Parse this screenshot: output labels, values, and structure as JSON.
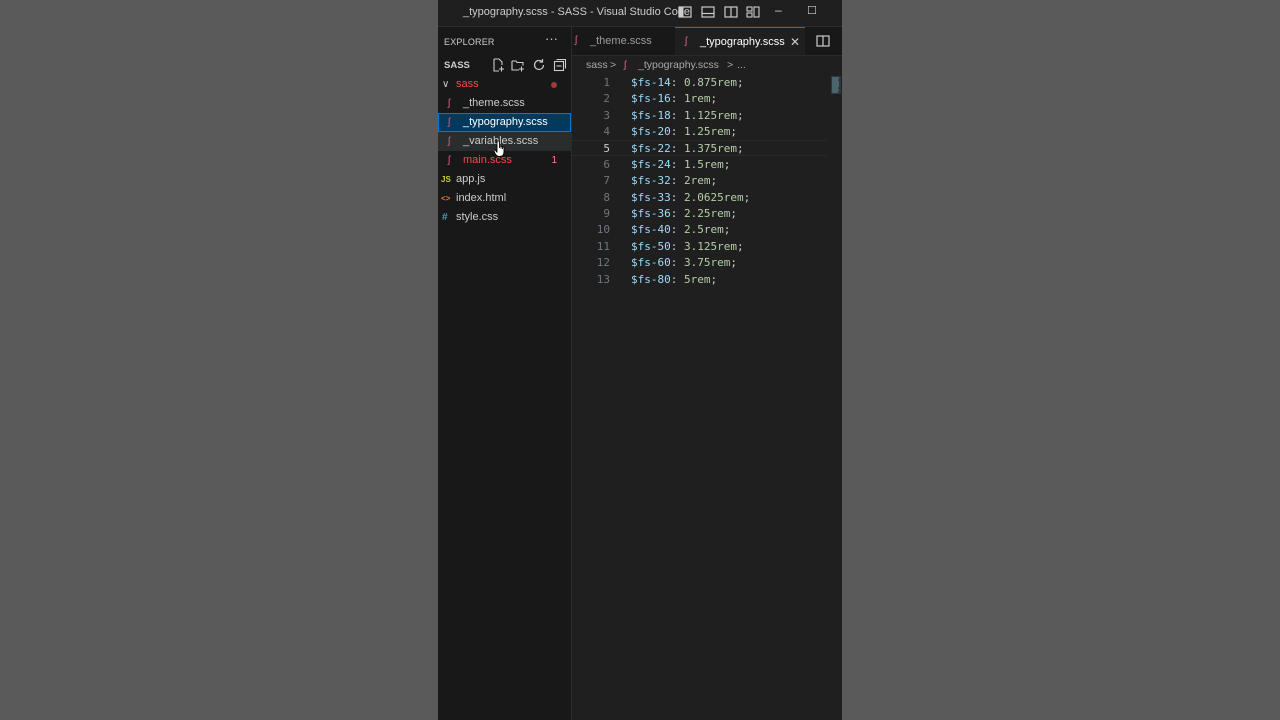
{
  "window": {
    "title": "_typography.scss - SASS - Visual Studio Code",
    "minimize_glyph": "–",
    "maximize_glyph": "☐"
  },
  "sidebar": {
    "title": "EXPLORER",
    "more_glyph": "···",
    "root": "SASS",
    "items": [
      {
        "label": "sass",
        "icon": "chevron-down-icon",
        "icon_glyph": "∨",
        "color": "#f14c4c"
      },
      {
        "label": "_theme.scss",
        "icon": "sass-file-icon",
        "icon_glyph": "ʃ",
        "color": "#cccccc"
      },
      {
        "label": "_typography.scss",
        "icon": "sass-file-icon",
        "icon_glyph": "ʃ",
        "color": "#ffffff"
      },
      {
        "label": "_variables.scss",
        "icon": "sass-file-icon",
        "icon_glyph": "ʃ",
        "color": "#cccccc"
      },
      {
        "label": "main.scss",
        "icon": "sass-file-icon",
        "icon_glyph": "ʃ",
        "color": "#f14c4c",
        "badge": "1"
      },
      {
        "label": "app.js",
        "icon": "js-file-icon",
        "icon_glyph": "JS",
        "color": "#cccccc"
      },
      {
        "label": "index.html",
        "icon": "html-file-icon",
        "icon_glyph": "<>",
        "color": "#cccccc"
      },
      {
        "label": "style.css",
        "icon": "css-file-icon",
        "icon_glyph": "#",
        "color": "#cccccc"
      }
    ]
  },
  "tabs": [
    {
      "label": "_theme.scss",
      "icon_glyph": "ʃ",
      "active": false
    },
    {
      "label": "_typography.scss",
      "icon_glyph": "ʃ",
      "active": true,
      "close_glyph": "✕"
    }
  ],
  "breadcrumb": {
    "folder": "sass",
    "separator": ">",
    "file_icon_glyph": "ʃ",
    "file": "_typography.scss",
    "ellipsis": "..."
  },
  "editor": {
    "current_line": 5,
    "lines": [
      {
        "n": "1",
        "var": "$fs-14",
        "val": "0.875rem"
      },
      {
        "n": "2",
        "var": "$fs-16",
        "val": "1rem"
      },
      {
        "n": "3",
        "var": "$fs-18",
        "val": "1.125rem"
      },
      {
        "n": "4",
        "var": "$fs-20",
        "val": "1.25rem"
      },
      {
        "n": "5",
        "var": "$fs-22",
        "val": "1.375rem"
      },
      {
        "n": "6",
        "var": "$fs-24",
        "val": "1.5rem"
      },
      {
        "n": "7",
        "var": "$fs-32",
        "val": "2rem"
      },
      {
        "n": "8",
        "var": "$fs-33",
        "val": "2.0625rem"
      },
      {
        "n": "9",
        "var": "$fs-36",
        "val": "2.25rem"
      },
      {
        "n": "10",
        "var": "$fs-40",
        "val": "2.5rem"
      },
      {
        "n": "11",
        "var": "$fs-50",
        "val": "3.125rem"
      },
      {
        "n": "12",
        "var": "$fs-60",
        "val": "3.75rem"
      },
      {
        "n": "13",
        "var": "$fs-80",
        "val": "5rem"
      }
    ]
  },
  "colors": {
    "sass_icon": "#e05d8a",
    "js_icon": "#cbcb41",
    "html_icon": "#e37933",
    "css_icon": "#519aba",
    "accent": "#0078d4"
  }
}
